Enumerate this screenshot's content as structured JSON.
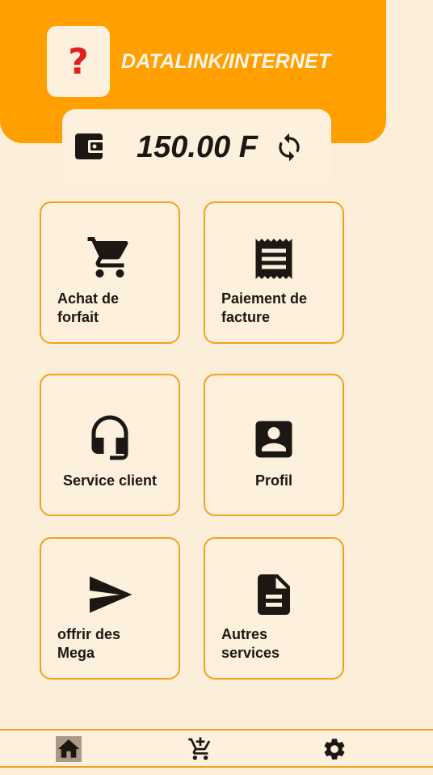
{
  "header": {
    "logo_glyph": "?",
    "title": "DATALINK/INTERNET",
    "color": "#ff9f00"
  },
  "balance": {
    "amount": "150.00 F",
    "wallet_icon": "wallet-icon",
    "refresh_icon": "refresh-icon"
  },
  "tiles": [
    {
      "label_line1": "Achat de",
      "label_line2": "forfait",
      "icon": "cart-icon"
    },
    {
      "label_line1": "Paiement de",
      "label_line2": "facture",
      "icon": "receipt-icon"
    },
    {
      "label_line1": "Service client",
      "icon": "headset-icon"
    },
    {
      "label_line1": "Profil",
      "icon": "contact-icon"
    },
    {
      "label_line1": "offrir des",
      "label_line2": "Mega",
      "icon": "send-icon"
    },
    {
      "label_line1": "Autres",
      "label_line2": "services",
      "icon": "document-icon"
    }
  ],
  "bottom_nav": [
    {
      "icon": "home-icon",
      "active": true
    },
    {
      "icon": "add-cart-icon"
    },
    {
      "icon": "gear-icon"
    }
  ],
  "colors": {
    "background": "#fbefd9",
    "card": "#fdf0dc",
    "border": "#f0a21e",
    "text": "#1c1713"
  }
}
